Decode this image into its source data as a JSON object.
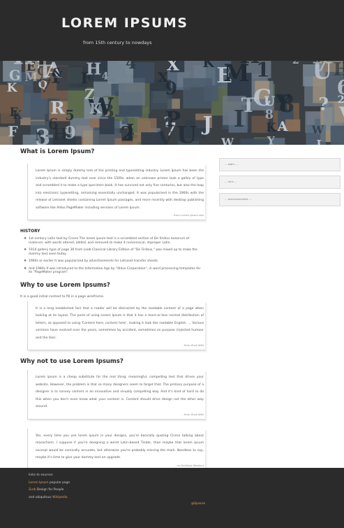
{
  "header": {
    "title": "LOREM IPSUMS",
    "tagline": "from 15th century to nowdays"
  },
  "sections": {
    "what": {
      "heading": "What is Lorem Ipsum?",
      "quote": "Lorem Ipsum is simply dummy text of the printing and typesetting industry. Lorem Ipsum has been the industry's standard dummy text ever since the 1500s, when an unknown printer took a galley of type and scrambled it to make a type specimen book. It has survived not only five centuries, but also the leap into electronic typesetting, remaining essentially unchanged. It was popularised in the 1960s with the release of Letraset sheets containing Lorem Ipsum passages, and more recently with desktop publishing software like Aldus PageMaker including versions of Lorem Ipsum.",
      "cite": "- from Lorem Ipsum site"
    },
    "history": {
      "heading": "HISTORY",
      "items": [
        {
          "pre": "1st-century Latin text by Cicero The lorem ipsum text is a scrambled section of ",
          "em": "De finibus bonorum et malorum",
          "post": ", with words altered, added, and removed to make it nonsensical, improper Latin."
        },
        {
          "pre": "1914 gallery type of page 36 from Loeb Classical Library Edition of \"De Finibus,\" was mixed up to make the dummy text seen today.",
          "em": "",
          "post": ""
        },
        {
          "pre": "1960s or earlier It was popularized by advertisements for Letraset transfer sheets.",
          "em": "",
          "post": ""
        },
        {
          "pre": "mid-1980s It was introduced to the Information Age by \"Aldus Corporation\", in word processing templates for its \"PageMaker program\".",
          "em": "",
          "post": ""
        }
      ]
    },
    "why": {
      "heading": "Why to use Lorem Ipsums?",
      "intro": "It is a good initial context to fill in a page wireframe.",
      "quote": "It is a long established fact that a reader will be distracted by the readable content of a page when looking at its layout. The point of using Lorem Ipsum is that it has a more-or-less normal distribution of letters, as opposed to using 'Content here, content here', making it look like readable English. ... Various versions have evolved over the years, sometimes by accident, sometimes on purpose (injected humour and the like).",
      "cite": "- from Zurb Wiki"
    },
    "whynot": {
      "heading": "Why not to use Lorem Ipsums?",
      "quote1": "Lorem ipsum is a cheap substitute for the real thing: meaningful, compelling text that drives your website. However, the problem is that so many designers seem to forget that. The primary purpose of a designer is to convey content in an innovative and visually compelling way. And it's kind of hard to do this when you don't even know what your content is. Content should drive design not the other way around.",
      "cite1": "- from Zurb Wiki",
      "quote2": "Yes, every time you use lorem ipsum in your designs, you're basically quoting Cicero talking about masochism. I suppose if you're designing a weird Latin-based Tinder, then maybe that lorem ipsum excerpt would be comically accurate, but otherwise you're probably missing the mark. Needless to say, maybe it's time to give your dummy text an upgrade.",
      "cite2": "- on HubSpot Medium"
    }
  },
  "sidebar": {
    "widgets": [
      {
        "label": "... add's ..."
      },
      {
        "label": "... rss's ..."
      },
      {
        "label": "... announcements ..."
      }
    ]
  },
  "footer": {
    "line1": "links to sources:",
    "line2_link": "Lorem Ipsum",
    "line2_rest": " popular page",
    "line3_link": "Zurb",
    "line3_rest": " Design for People",
    "line4_pre": "and ubiquitous ",
    "line4_link": "Wikipedia",
    "totop": "@Spaces"
  },
  "colors": {
    "header_bg": "#2b2b2b",
    "footer_link": "#d6a45a"
  }
}
